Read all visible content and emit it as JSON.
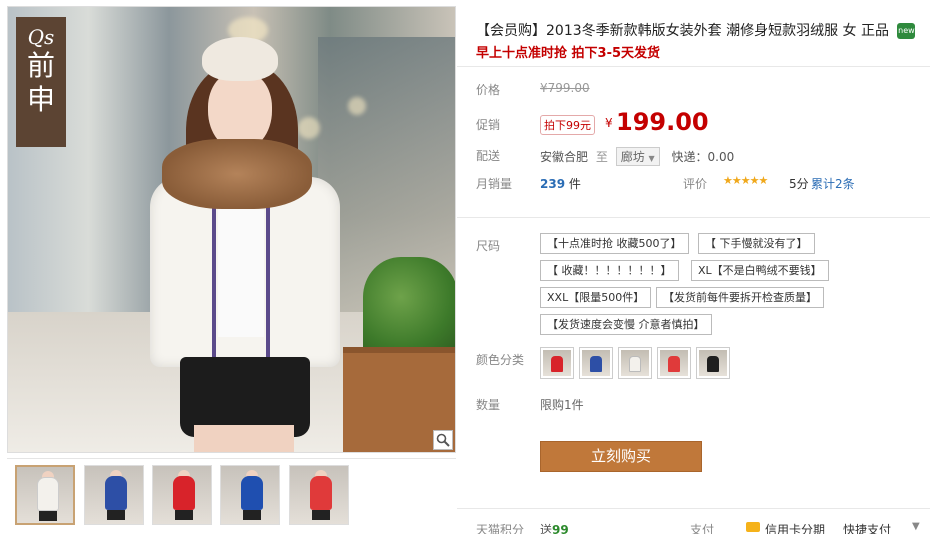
{
  "gallery": {
    "logo_line1": "Qs",
    "logo_line2": "前申",
    "thumbnails": [
      {
        "coat_color": "#f3f1ec"
      },
      {
        "coat_color": "#2d4fa6"
      },
      {
        "coat_color": "#d8232a"
      },
      {
        "coat_color": "#1f4fb0"
      },
      {
        "coat_color": "#e03a3a"
      }
    ]
  },
  "product": {
    "title": "【会员购】2013冬季新款韩版女装外套 潮修身短款羽绒服 女 正品",
    "new_badge": "new",
    "subtitle": "早上十点准时抢 拍下3-5天发货"
  },
  "price": {
    "label": "价格",
    "original": "¥799.00",
    "promo_label": "促销",
    "promo_tag": "拍下99元",
    "currency": "¥",
    "value": "199.00"
  },
  "shipping": {
    "label": "配送",
    "origin": "安徽合肥",
    "to": "至",
    "destination": "廊坊",
    "fee": "快递：0.00"
  },
  "sales": {
    "label": "月销量",
    "count": "239",
    "unit": "件",
    "rating_label": "评价",
    "stars": "★★★★★",
    "score": "5分",
    "reviews": "累计2条"
  },
  "size": {
    "label": "尺码",
    "options": [
      "【十点准时抢 收藏500了】",
      "【 下手慢就没有了】",
      "【 收藏！！！！！！！】",
      "XL【不是白鸭绒不要钱】",
      "XXL【限量500件】",
      "【发货前每件要拆开检查质量】",
      "【发货速度会变慢 介意者慎拍】"
    ]
  },
  "color": {
    "label": "颜色分类",
    "options": [
      {
        "color": "#d8232a"
      },
      {
        "color": "#2d4fa6"
      },
      {
        "color": "#f3f1ec"
      },
      {
        "color": "#e03a3a"
      },
      {
        "color": "#1f1f1f"
      }
    ]
  },
  "quantity": {
    "label": "数量",
    "limit": "限购1件"
  },
  "buy_button": "立刻购买",
  "footer": {
    "points_label": "天猫积分",
    "points_text": "送",
    "points_value": "99",
    "pay_label": "支付",
    "credit": "信用卡分期",
    "quick": "快捷支付",
    "caret": "▼"
  }
}
